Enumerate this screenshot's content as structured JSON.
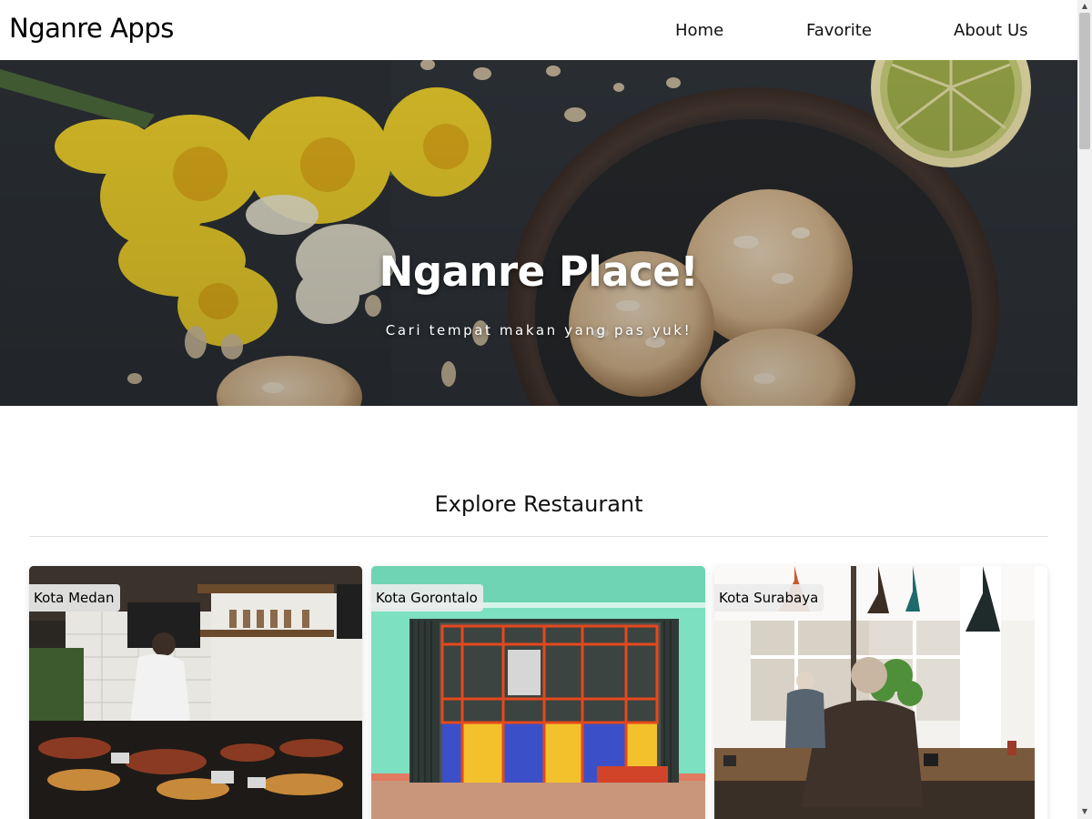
{
  "header": {
    "logo": "Nganre Apps",
    "nav": {
      "home": "Home",
      "favorite": "Favorite",
      "about": "About Us"
    }
  },
  "hero": {
    "title": "Nganre Place!",
    "subtitle": "Cari tempat makan yang pas yuk!"
  },
  "explore": {
    "title": "Explore Restaurant",
    "restaurants": [
      {
        "city": "Kota Medan",
        "image": "restaurant-kitchen-image"
      },
      {
        "city": "Kota Gorontalo",
        "image": "restaurant-storefront-image"
      },
      {
        "city": "Kota Surabaya",
        "image": "restaurant-cafe-image"
      }
    ]
  },
  "colors": {
    "hero_bg": "#2a2f34",
    "divider": "#e2e2e2",
    "tag_bg": "#ebebeb"
  },
  "icons": [
    "scroll-up-arrow-icon",
    "scroll-down-arrow-icon"
  ]
}
